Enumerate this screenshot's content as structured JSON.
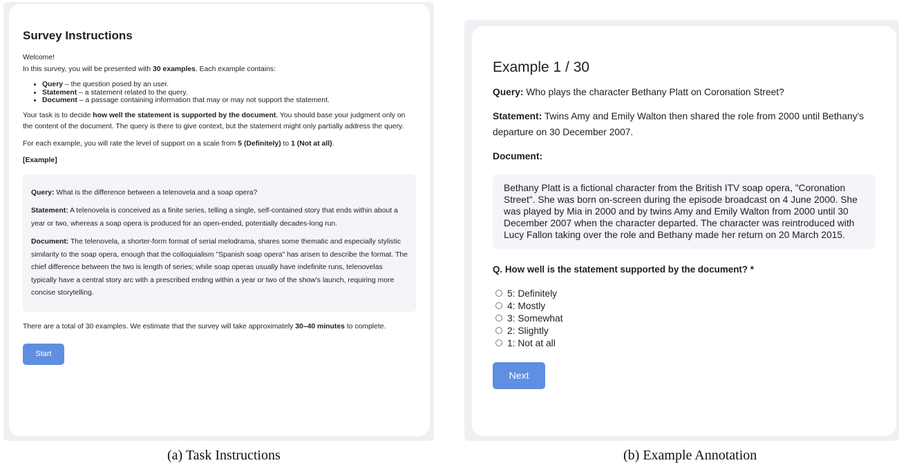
{
  "panel_a": {
    "title": "Survey Instructions",
    "welcome": "Welcome!",
    "intro_before": "In this survey, you will be presented with ",
    "intro_bold": "30 examples",
    "intro_after": ". Each example contains:",
    "items": [
      {
        "term": "Query",
        "desc": " – the question posed by an user."
      },
      {
        "term": "Statement",
        "desc": " – a statement related to the query."
      },
      {
        "term": "Document",
        "desc": " – a passage containing information that may or may not support the statement."
      }
    ],
    "task_before": "Your task is to decide ",
    "task_bold": "how well the statement is supported by the document",
    "task_after": ". You should base your judgment only on the content of the document. The query is there to give context, but the statement might only partially address the query.",
    "scale_before": "For each example, you will rate the level of support on a scale from ",
    "scale_bold1": "5 (Definitely)",
    "scale_mid": " to ",
    "scale_bold2": "1 (Not at all)",
    "scale_after": ".",
    "example_label": "[Example]",
    "example": {
      "query_label": "Query:",
      "query": " What is the difference between a telenovela and a soap opera?",
      "statement_label": "Statement:",
      "statement": " A telenovela is conceived as a finite series, telling a single, self-contained story that ends within about a year or two, whereas a soap opera is produced for an open-ended, potentially decades-long run.",
      "document_label": "Document:",
      "document": " The telenovela, a shorter-form format of serial melodrama, shares some thematic and especially stylistic similarity to the soap opera, enough that the colloquialism \"Spanish soap opera\" has arisen to describe the format. The chief difference between the two is length of series; while soap operas usually have indefinite runs, telenovelas typically have a central story arc with a prescribed ending within a year or two of the show's launch, requiring more concise storytelling."
    },
    "total_before": "There are a total of 30 examples. We estimate that the survey will take approximately ",
    "total_bold": "30–40 minutes",
    "total_after": " to complete.",
    "start_label": "Start"
  },
  "panel_b": {
    "title": "Example 1 / 30",
    "query_label": "Query:",
    "query": " Who plays the character Bethany Platt on Coronation Street?",
    "statement_label": "Statement:",
    "statement": " Twins Amy and Emily Walton then shared the role from 2000 until Bethany's departure on 30 December 2007.",
    "document_label": "Document:",
    "document": "Bethany Platt is a fictional character from the British ITV soap opera, \"Coronation Street\". She was born on-screen during the episode broadcast on 4 June 2000. She was played by Mia in 2000 and by twins Amy and Emily Walton from 2000 until 30 December 2007 when the character departed. The character was reintroduced with Lucy Fallon taking over the role and Bethany made her return on 20 March 2015.",
    "question": "Q. How well is the statement supported by the document? *",
    "options": [
      "5: Definitely",
      "4: Mostly",
      "3: Somewhat",
      "2: Slightly",
      "1: Not at all"
    ],
    "next_label": "Next"
  },
  "captions": {
    "a": "(a) Task Instructions",
    "b": "(b) Example Annotation"
  }
}
